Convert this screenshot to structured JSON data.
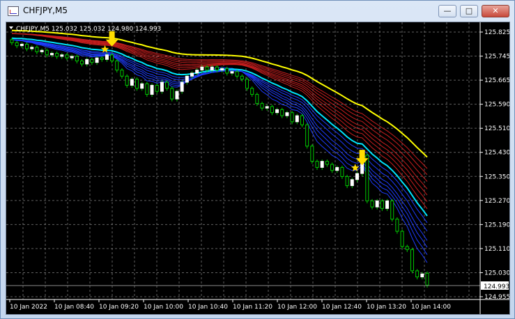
{
  "window": {
    "title": "CHFJPY,M5",
    "min_label": "—",
    "max_label": "□",
    "close_label": "✕"
  },
  "chart": {
    "info": "CHFJPY,M5  125.032 125.032 124.980 124.993",
    "current_price": "124.993",
    "colors": {
      "bg": "#000000",
      "grid": "#8a8a8a",
      "bull": "#ffffff",
      "bear": "#00cc00",
      "yellow": "#ffff00",
      "red": "#c81e1e",
      "cyan": "#00e5ff",
      "blue": "#1e3cff",
      "arrow": "#ffdd00"
    },
    "y_labels": [
      "125.825",
      "125.745",
      "125.665",
      "125.590",
      "125.510",
      "125.430",
      "125.350",
      "125.270",
      "125.190",
      "125.110",
      "125.030",
      "124.955"
    ],
    "x_labels": [
      "10 Jan 2022",
      "10 Jan 08:40",
      "10 Jan 09:20",
      "10 Jan 10:00",
      "10 Jan 10:40",
      "10 Jan 11:20",
      "10 Jan 12:00",
      "10 Jan 12:40",
      "10 Jan 13:20",
      "10 Jan 14:00"
    ]
  },
  "chart_data": {
    "type": "candlestick",
    "symbol": "CHFJPY",
    "timeframe": "M5",
    "ylim": [
      124.955,
      125.825
    ],
    "candles": [
      {
        "o": 125.8,
        "c": 125.79
      },
      {
        "o": 125.79,
        "c": 125.78
      },
      {
        "o": 125.78,
        "c": 125.785
      },
      {
        "o": 125.785,
        "c": 125.77
      },
      {
        "o": 125.77,
        "c": 125.775
      },
      {
        "o": 125.775,
        "c": 125.76
      },
      {
        "o": 125.76,
        "c": 125.765
      },
      {
        "o": 125.765,
        "c": 125.75
      },
      {
        "o": 125.75,
        "c": 125.755
      },
      {
        "o": 125.755,
        "c": 125.745
      },
      {
        "o": 125.745,
        "c": 125.75
      },
      {
        "o": 125.75,
        "c": 125.74
      },
      {
        "o": 125.74,
        "c": 125.745
      },
      {
        "o": 125.745,
        "c": 125.73
      },
      {
        "o": 125.73,
        "c": 125.72
      },
      {
        "o": 125.72,
        "c": 125.735
      },
      {
        "o": 125.735,
        "c": 125.725
      },
      {
        "o": 125.725,
        "c": 125.74
      },
      {
        "o": 125.74,
        "c": 125.735
      },
      {
        "o": 125.735,
        "c": 125.75
      },
      {
        "o": 125.75,
        "c": 125.73
      },
      {
        "o": 125.73,
        "c": 125.7
      },
      {
        "o": 125.7,
        "c": 125.68
      },
      {
        "o": 125.68,
        "c": 125.65
      },
      {
        "o": 125.65,
        "c": 125.67
      },
      {
        "o": 125.67,
        "c": 125.64
      },
      {
        "o": 125.64,
        "c": 125.655
      },
      {
        "o": 125.655,
        "c": 125.62
      },
      {
        "o": 125.62,
        "c": 125.65
      },
      {
        "o": 125.65,
        "c": 125.63
      },
      {
        "o": 125.63,
        "c": 125.66
      },
      {
        "o": 125.66,
        "c": 125.64
      },
      {
        "o": 125.64,
        "c": 125.605
      },
      {
        "o": 125.605,
        "c": 125.63
      },
      {
        "o": 125.63,
        "c": 125.66
      },
      {
        "o": 125.66,
        "c": 125.68
      },
      {
        "o": 125.68,
        "c": 125.69
      },
      {
        "o": 125.69,
        "c": 125.7
      },
      {
        "o": 125.7,
        "c": 125.71
      },
      {
        "o": 125.71,
        "c": 125.7
      },
      {
        "o": 125.7,
        "c": 125.71
      },
      {
        "o": 125.71,
        "c": 125.7
      },
      {
        "o": 125.7,
        "c": 125.705
      },
      {
        "o": 125.705,
        "c": 125.69
      },
      {
        "o": 125.69,
        "c": 125.695
      },
      {
        "o": 125.695,
        "c": 125.68
      },
      {
        "o": 125.68,
        "c": 125.67
      },
      {
        "o": 125.67,
        "c": 125.64
      },
      {
        "o": 125.64,
        "c": 125.62
      },
      {
        "o": 125.62,
        "c": 125.59
      },
      {
        "o": 125.59,
        "c": 125.575
      },
      {
        "o": 125.575,
        "c": 125.58
      },
      {
        "o": 125.58,
        "c": 125.56
      },
      {
        "o": 125.56,
        "c": 125.57
      },
      {
        "o": 125.57,
        "c": 125.55
      },
      {
        "o": 125.55,
        "c": 125.56
      },
      {
        "o": 125.56,
        "c": 125.53
      },
      {
        "o": 125.53,
        "c": 125.55
      },
      {
        "o": 125.55,
        "c": 125.52
      },
      {
        "o": 125.52,
        "c": 125.45
      },
      {
        "o": 125.45,
        "c": 125.4
      },
      {
        "o": 125.4,
        "c": 125.38
      },
      {
        "o": 125.38,
        "c": 125.4
      },
      {
        "o": 125.4,
        "c": 125.39
      },
      {
        "o": 125.39,
        "c": 125.37
      },
      {
        "o": 125.37,
        "c": 125.38
      },
      {
        "o": 125.38,
        "c": 125.35
      },
      {
        "o": 125.35,
        "c": 125.32
      },
      {
        "o": 125.32,
        "c": 125.34
      },
      {
        "o": 125.34,
        "c": 125.36
      },
      {
        "o": 125.36,
        "c": 125.42
      },
      {
        "o": 125.42,
        "c": 125.27
      },
      {
        "o": 125.27,
        "c": 125.25
      },
      {
        "o": 125.25,
        "c": 125.27
      },
      {
        "o": 125.27,
        "c": 125.245
      },
      {
        "o": 125.245,
        "c": 125.27
      },
      {
        "o": 125.27,
        "c": 125.21
      },
      {
        "o": 125.21,
        "c": 125.17
      },
      {
        "o": 125.17,
        "c": 125.12
      },
      {
        "o": 125.12,
        "c": 125.11
      },
      {
        "o": 125.11,
        "c": 125.04
      },
      {
        "o": 125.04,
        "c": 125.02
      },
      {
        "o": 125.02,
        "c": 125.03
      },
      {
        "o": 125.032,
        "c": 124.993
      }
    ],
    "signals": [
      {
        "index": 20,
        "type": "sell"
      },
      {
        "index": 70,
        "type": "sell"
      }
    ]
  }
}
